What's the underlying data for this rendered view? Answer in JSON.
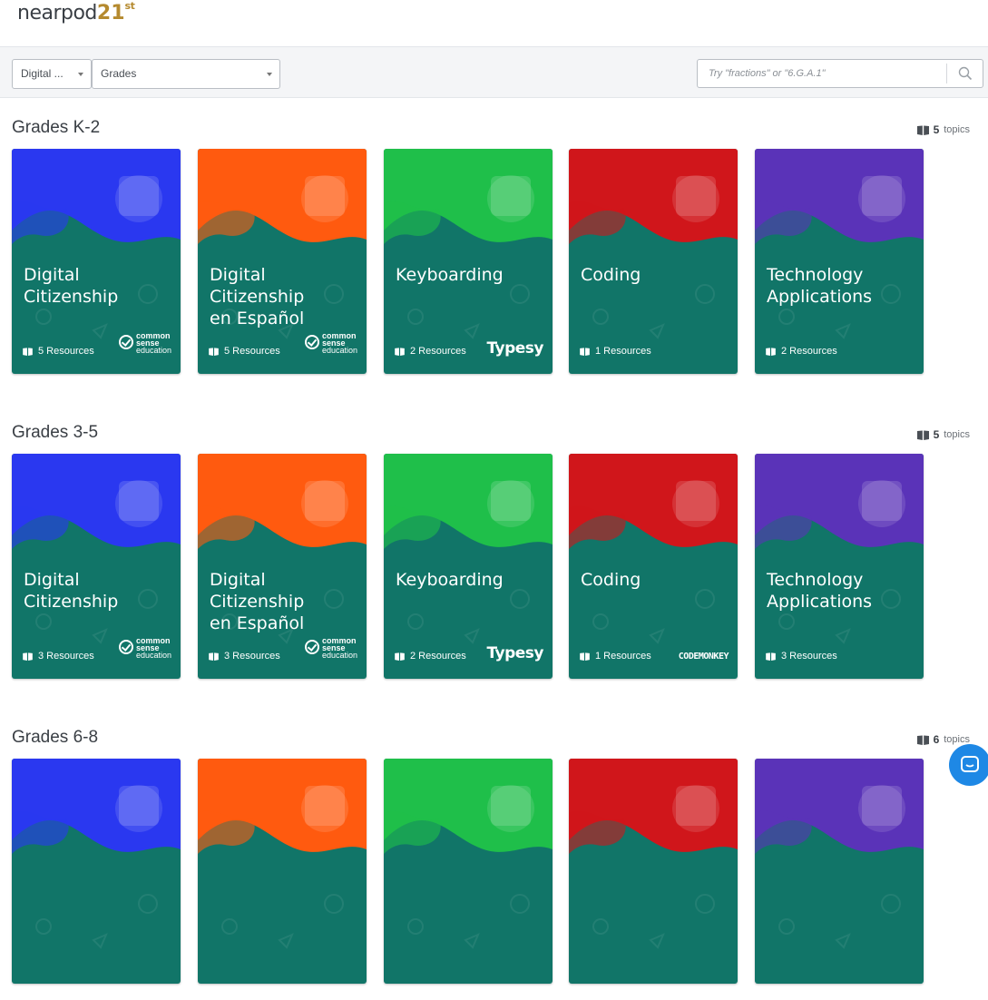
{
  "app": {
    "logo_text": "nearpod",
    "logo_number": "21",
    "logo_suffix": "st"
  },
  "filters": {
    "subject": {
      "selected": "Digital ..."
    },
    "grades": {
      "selected": "Grades"
    },
    "search": {
      "placeholder": "Try \"fractions\" or \"6.G.A.1\"",
      "value": ""
    }
  },
  "colors": {
    "teal": "#117568",
    "blue": "#2a38f0",
    "orange": "#ff5a0f",
    "green": "#1fbf4a",
    "red": "#d0161b",
    "purple": "#5a33b8"
  },
  "sections": [
    {
      "title": "Grades K-2",
      "count": "5",
      "count_label": "topics",
      "cards": [
        {
          "title_line1": "Digital Citizenship",
          "title_line2": "",
          "resources": "5 Resources",
          "theme": "blue",
          "brand": "commonsense"
        },
        {
          "title_line1": "Digital Citizenship",
          "title_line2": "en Español",
          "resources": "5 Resources",
          "theme": "orange",
          "brand": "commonsense"
        },
        {
          "title_line1": "Keyboarding",
          "title_line2": "",
          "resources": "2 Resources",
          "theme": "green",
          "brand": "typesy"
        },
        {
          "title_line1": "Coding",
          "title_line2": "",
          "resources": "1 Resources",
          "theme": "red",
          "brand": ""
        },
        {
          "title_line1": "Technology",
          "title_line2": "Applications",
          "resources": "2 Resources",
          "theme": "purple",
          "brand": ""
        }
      ]
    },
    {
      "title": "Grades 3-5",
      "count": "5",
      "count_label": "topics",
      "cards": [
        {
          "title_line1": "Digital Citizenship",
          "title_line2": "",
          "resources": "3 Resources",
          "theme": "blue",
          "brand": "commonsense"
        },
        {
          "title_line1": "Digital Citizenship",
          "title_line2": "en Español",
          "resources": "3 Resources",
          "theme": "orange",
          "brand": "commonsense"
        },
        {
          "title_line1": "Keyboarding",
          "title_line2": "",
          "resources": "2 Resources",
          "theme": "green",
          "brand": "typesy"
        },
        {
          "title_line1": "Coding",
          "title_line2": "",
          "resources": "1 Resources",
          "theme": "red",
          "brand": "codemonkey"
        },
        {
          "title_line1": "Technology",
          "title_line2": "Applications",
          "resources": "3 Resources",
          "theme": "purple",
          "brand": ""
        }
      ]
    },
    {
      "title": "Grades 6-8",
      "count": "6",
      "count_label": "topics",
      "cards": [
        {
          "theme": "blue"
        },
        {
          "theme": "orange"
        },
        {
          "theme": "green"
        },
        {
          "theme": "red"
        },
        {
          "theme": "purple"
        }
      ]
    }
  ],
  "brands": {
    "cs_line1": "common",
    "cs_line2": "sense",
    "cs_line3": "education",
    "typesy": "Typesy",
    "codemonkey": "CODEMONKEY"
  },
  "icons": {
    "search": "search-icon",
    "book": "book-icon",
    "chat": "chat-bubble-icon",
    "caret": "caret-down-icon"
  }
}
